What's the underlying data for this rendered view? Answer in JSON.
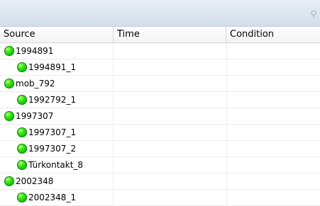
{
  "toolbar": {
    "search_icon": "search-icon"
  },
  "columns": {
    "source": "Source",
    "time": "Time",
    "condition": "Condition"
  },
  "rows": [
    {
      "label": "1994891",
      "level": 0,
      "status_color": "#22d40e",
      "time": "",
      "condition": ""
    },
    {
      "label": "1994891_1",
      "level": 1,
      "status_color": "#22d40e",
      "time": "",
      "condition": ""
    },
    {
      "label": "mob_792",
      "level": 0,
      "status_color": "#22d40e",
      "time": "",
      "condition": ""
    },
    {
      "label": "1992792_1",
      "level": 1,
      "status_color": "#22d40e",
      "time": "",
      "condition": ""
    },
    {
      "label": "1997307",
      "level": 0,
      "status_color": "#22d40e",
      "time": "",
      "condition": ""
    },
    {
      "label": "1997307_1",
      "level": 1,
      "status_color": "#22d40e",
      "time": "",
      "condition": ""
    },
    {
      "label": "1997307_2",
      "level": 1,
      "status_color": "#22d40e",
      "time": "",
      "condition": ""
    },
    {
      "label": "Türkontakt_8",
      "level": 1,
      "status_color": "#22d40e",
      "time": "",
      "condition": ""
    },
    {
      "label": "2002348",
      "level": 0,
      "status_color": "#22d40e",
      "time": "",
      "condition": ""
    },
    {
      "label": "2002348_1",
      "level": 1,
      "status_color": "#22d40e",
      "time": "",
      "condition": ""
    }
  ]
}
